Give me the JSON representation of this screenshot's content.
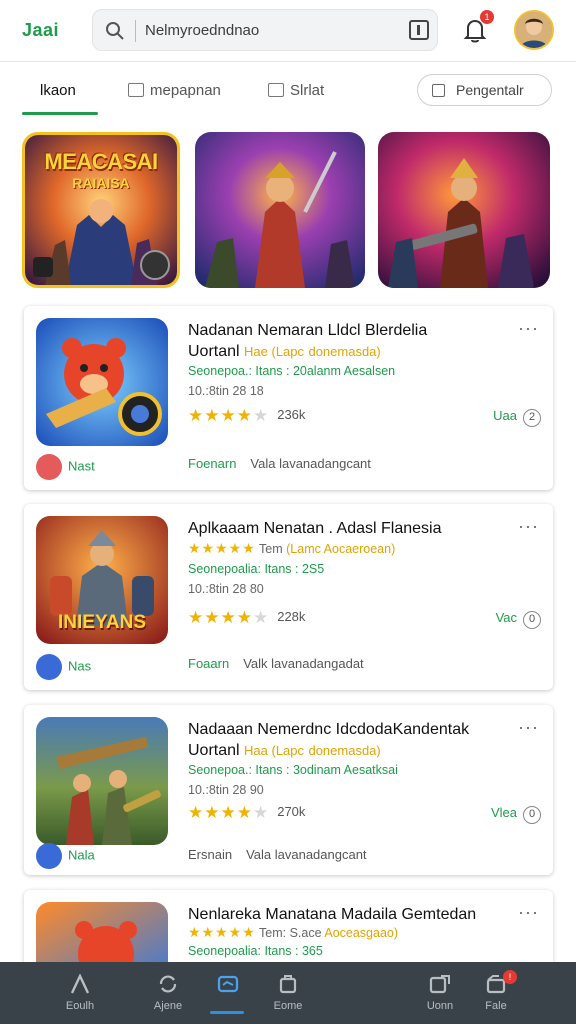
{
  "header": {
    "logo": "Jaai",
    "search_value": "Nelmyroedndnao",
    "notification_count": "1"
  },
  "tabs": [
    {
      "label": "lkaon",
      "active": true
    },
    {
      "label": "mepapnan"
    },
    {
      "label": "Slrlat"
    }
  ],
  "filter_pill": "Pengentalr",
  "featured": {
    "title": "MEACASAI",
    "subtitle": "RAIAISA"
  },
  "apps": [
    {
      "title_line1": "Nadanan Nemaran Lldcl Blerdelia",
      "title_line2": "Uortanl",
      "tag1": "Hae (Lapc",
      "tag2": "donemasda)",
      "meta": "Seonepoa.: Itans : 20alanm Aesalsen",
      "date": "10.:8tin 28 18",
      "rating_count": "236k",
      "action": "Uaa",
      "action_badge": "2",
      "author": "Nast",
      "foot_link": "Foenarn",
      "foot_text": "Vala lavanadangcant"
    },
    {
      "title_line1": "Aplkaaam Nenatan . Adasl Flanesia",
      "title_line2": "",
      "tag0": "Tem",
      "tag1": "(Lamc",
      "tag2": "Aocaeroean)",
      "meta": "Seonepoalia: Itans : 2S5",
      "date": "10.:8tin 28 80",
      "rating_count": "228k",
      "action": "Vac",
      "action_badge": "0",
      "author": "Nas",
      "foot_link": "Foaarn",
      "foot_text": "Valk lavanadangadat",
      "art_text": "INIEYANS"
    },
    {
      "title_line1": "Nadaaan Nemerdnc IdcdodaKandentak",
      "title_line2": "Uortanl",
      "tag1": "Haa (Lapc",
      "tag2": "donemasda)",
      "meta": "Seonepoa.: Itans : 3odinam Aesatksai",
      "date": "10.:8tin 28 90",
      "rating_count": "270k",
      "action": "Vlea",
      "action_badge": "0",
      "author": "Nala",
      "foot_link": "Ersnain",
      "foot_text": "Vala lavanadangcant"
    },
    {
      "title_line1": "Nenlareka Manatana Madaila Gemtedan",
      "title_line2": "",
      "tag0": "Tem:",
      "tag1": "S.ace",
      "tag2": "Aoceasgaao)",
      "meta": "Seonepoalia: Itans : 365"
    }
  ],
  "bottom_nav": [
    {
      "label": "Eoulh"
    },
    {
      "label": "Ajene"
    },
    {
      "label": "",
      "active": true
    },
    {
      "label": "Eome"
    },
    {
      "label": "Uonn"
    },
    {
      "label": "Fale",
      "badge": "!"
    }
  ],
  "colors": {
    "accent_green": "#1e9c4b",
    "star": "#f0b400",
    "tag_orange": "#e0a400",
    "nav_bg": "#3a4249",
    "nav_active": "#2f8fe0"
  }
}
